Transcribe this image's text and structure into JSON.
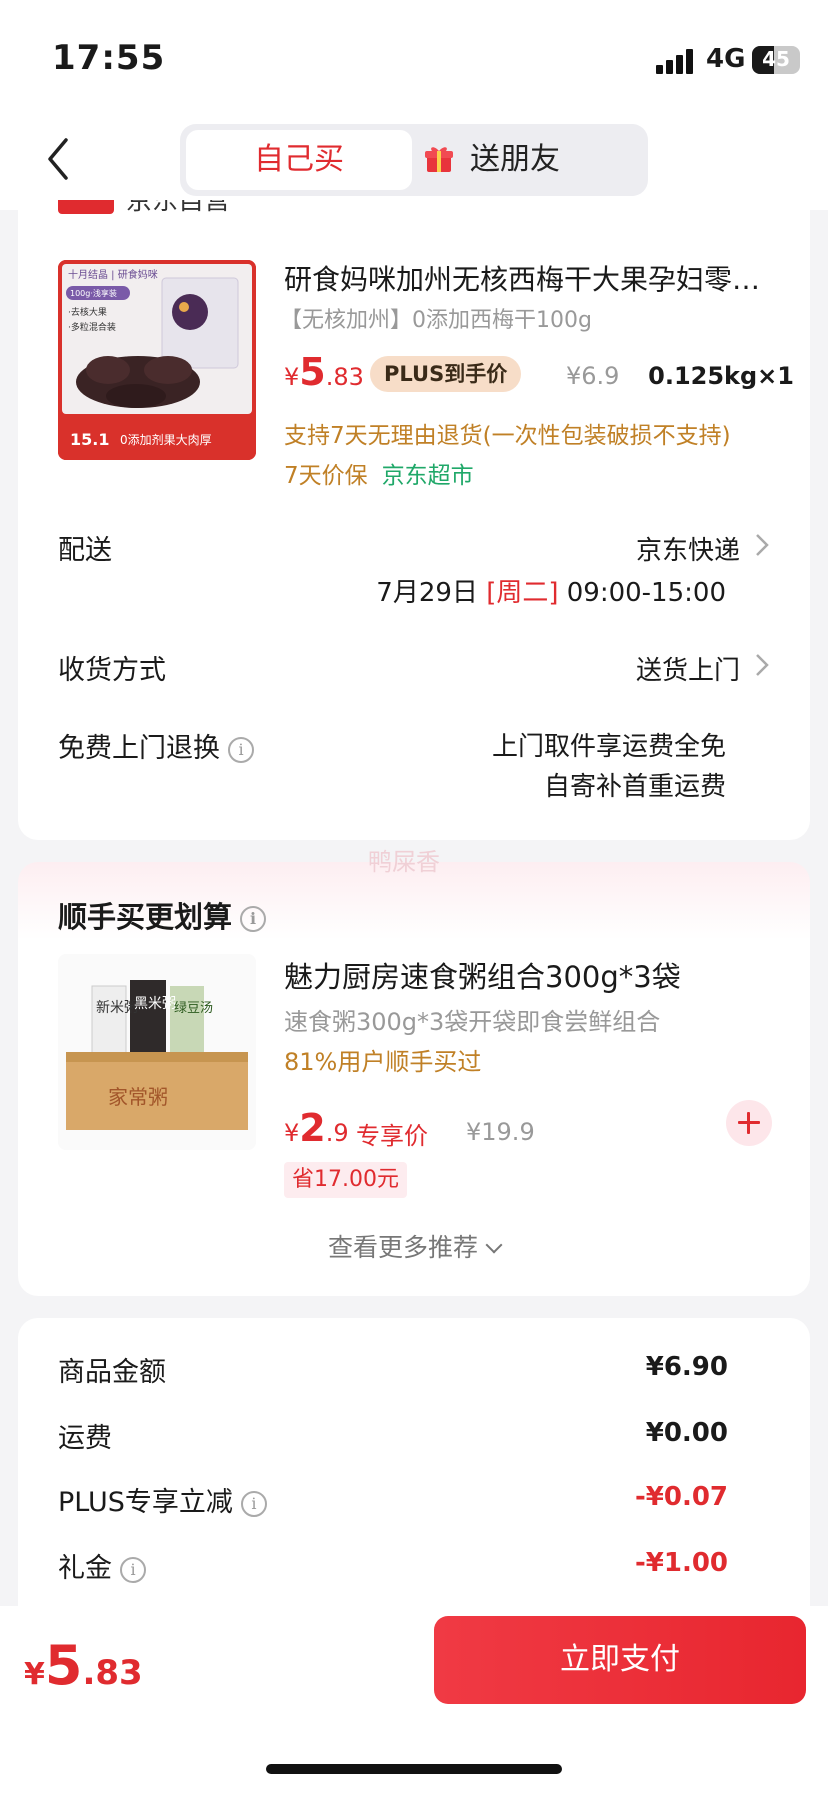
{
  "status": {
    "time": "17:55",
    "network": "4G",
    "battery": "45",
    "battery_level": 0.45
  },
  "nav": {
    "back_icon": "chevron-left-icon",
    "tab_self": "自己买",
    "tab_gift": "送朋友",
    "gift_icon": "gift-icon"
  },
  "product": {
    "store_label": "京东自营",
    "title": "研食妈咪加州无核西梅干大果孕妇零…",
    "spec": "【无核加州】0添加西梅干100g",
    "price_currency": "¥",
    "price_int": "5",
    "price_dec": ".83",
    "plus_badge": "PLUS到手价",
    "orig_price": "¥6.9",
    "weight_qty": "0.125kg×1",
    "return_policy": "支持7天无理由退货(一次性包装破损不支持)",
    "price_guard": "7天价保",
    "supermarket": "京东超市",
    "img_texts": {
      "brand": "十月结晶 | 研食妈咪",
      "pack": "100g·浅享装",
      "p1": "·去核大果",
      "p2": "·多粒混合装",
      "bottom": "0添加剂果大肉厚",
      "num": "15.1"
    }
  },
  "delivery": {
    "label": "配送",
    "carrier": "京东快递",
    "date": "7月29日",
    "weekday": "[周二]",
    "window": "09:00-15:00"
  },
  "receive": {
    "label": "收货方式",
    "value": "送货上门"
  },
  "free_return": {
    "label": "免费上门退换",
    "line1": "上门取件享运费全免",
    "line2": "自寄补首重运费"
  },
  "addon": {
    "watermark": "鸭屎香",
    "title": "顺手买更划算",
    "item_title": "魅力厨房速食粥组合300g*3袋",
    "item_spec": "速食粥300g*3袋开袋即食尝鲜组合",
    "item_stat": "81%用户顺手买过",
    "price_currency": "¥",
    "price_int": "2",
    "price_dec": ".9",
    "price_tag": "专享价",
    "orig_price": "¥19.9",
    "save_text": "省17.00元",
    "more_label": "查看更多推荐",
    "img_texts": {
      "a": "新米粥",
      "b": "黑米粥",
      "c": "绿豆汤",
      "box": "家常粥"
    }
  },
  "summary": {
    "rows": [
      {
        "label": "商品金额",
        "value": "¥6.90"
      },
      {
        "label": "运费",
        "value": "¥0.00"
      },
      {
        "label": "PLUS专享立减",
        "value": "-¥0.07"
      },
      {
        "label": "礼金",
        "value": "-¥1.00"
      }
    ]
  },
  "footer": {
    "currency": "¥",
    "total_int": "5",
    "total_dec": ".83",
    "pay_label": "立即支付"
  },
  "colors": {
    "accent": "#e02b2f",
    "gold": "#c08026",
    "green": "#20a869"
  }
}
